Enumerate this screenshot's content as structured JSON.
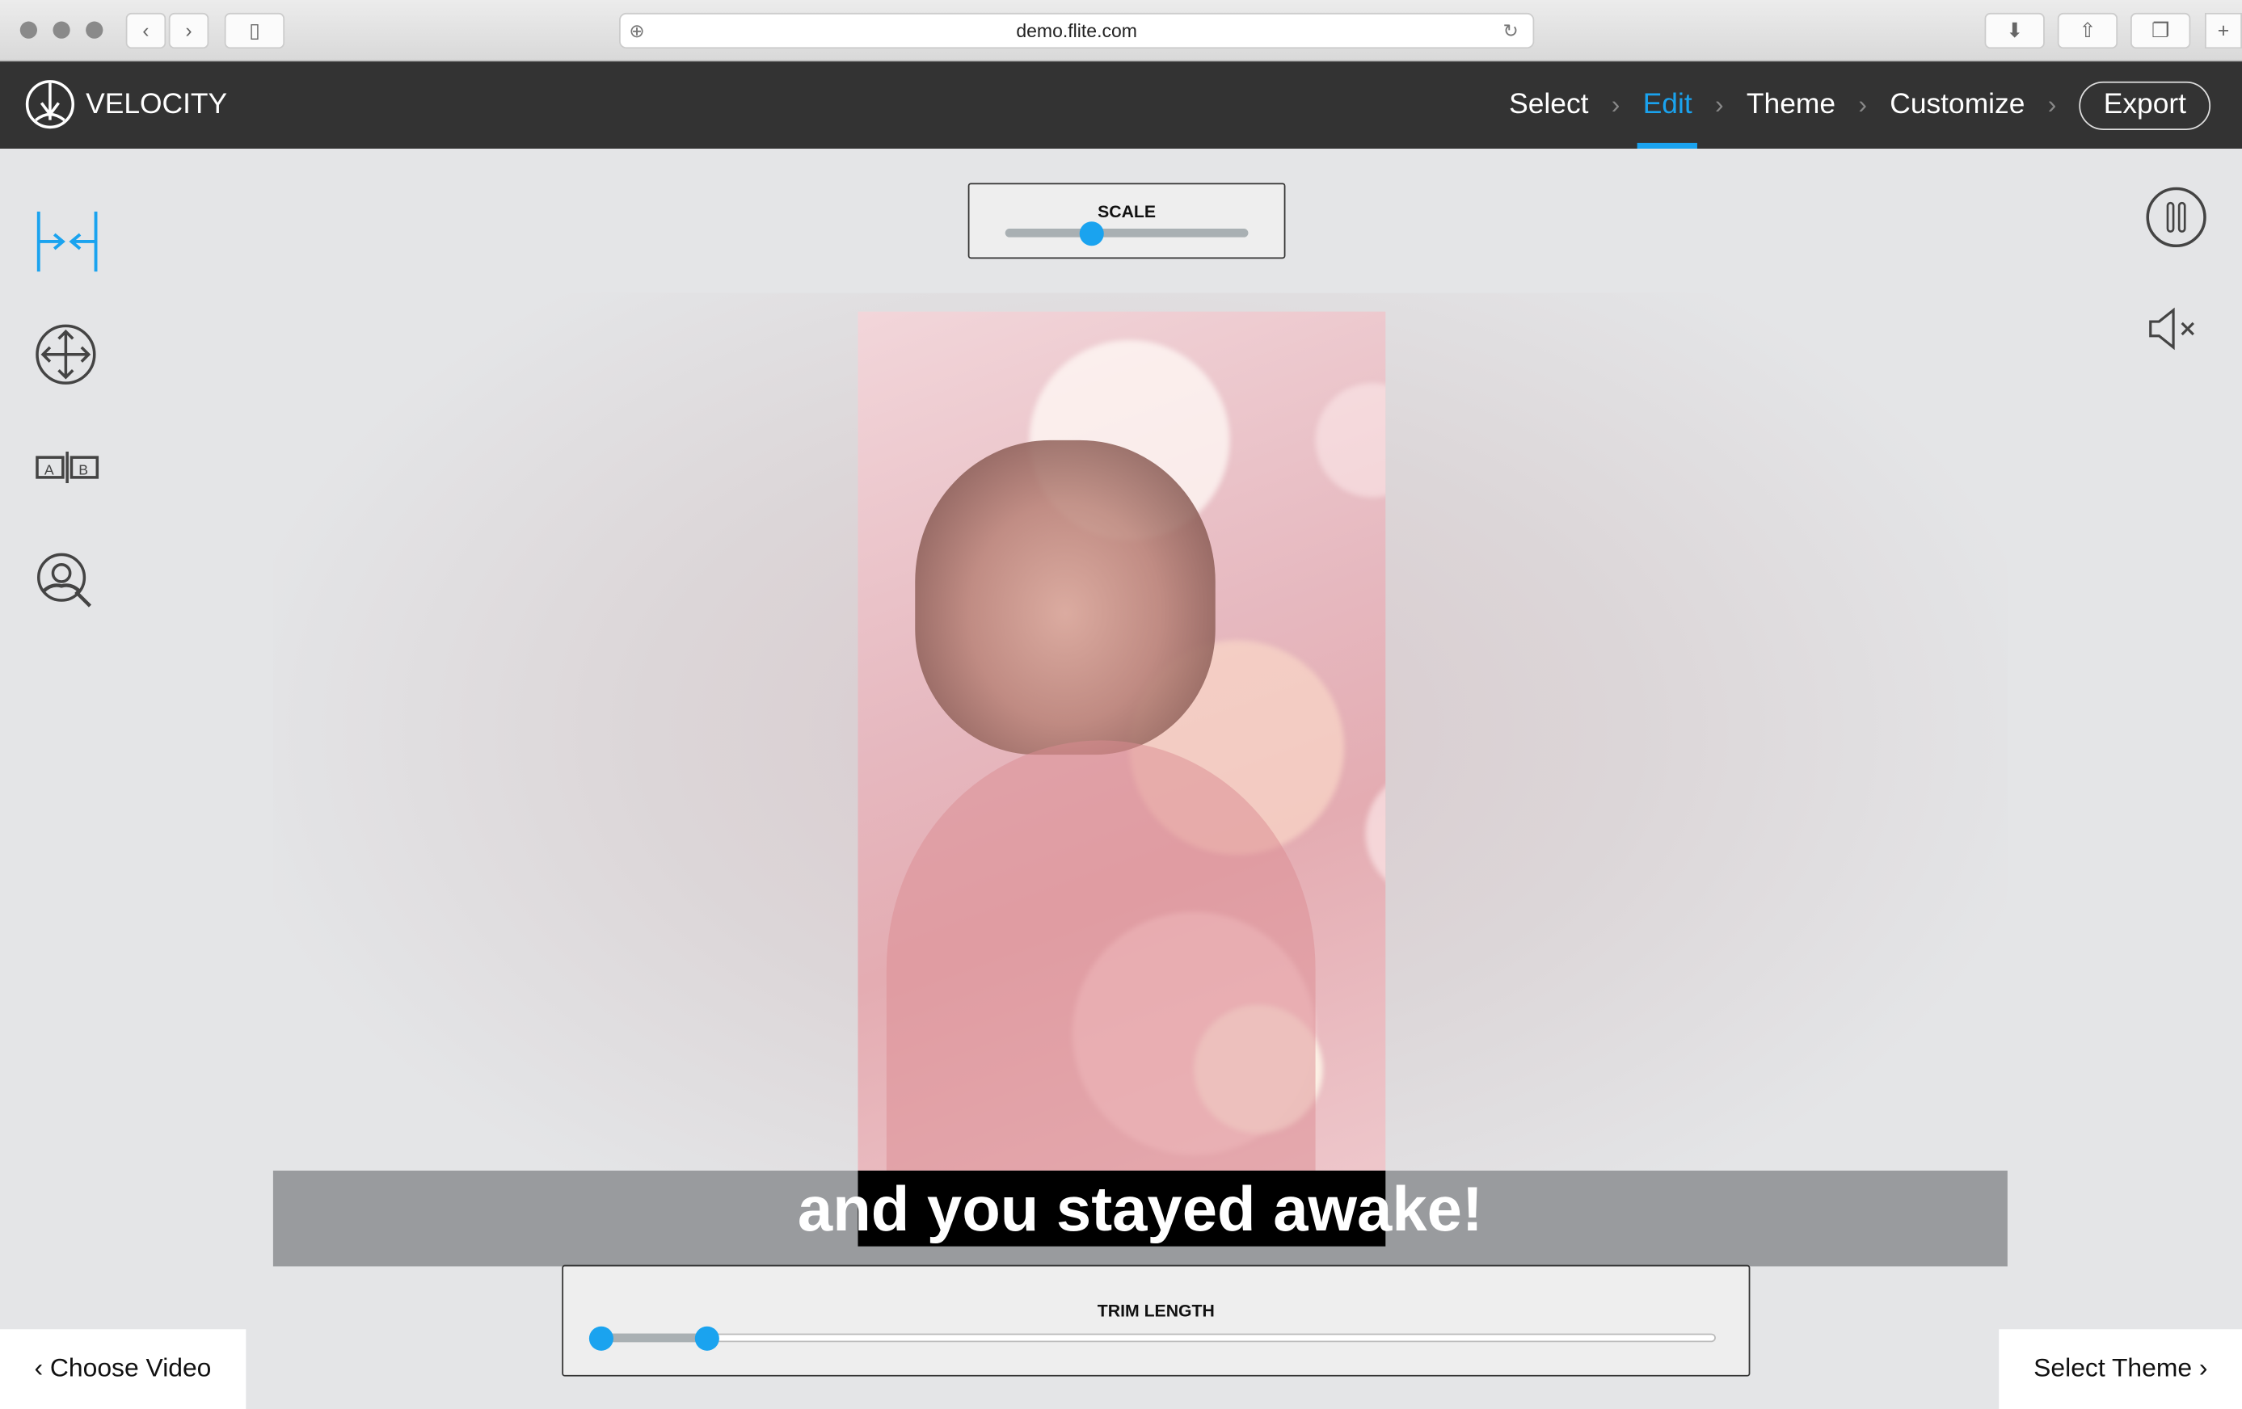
{
  "browser": {
    "url": "demo.flite.com"
  },
  "app": {
    "brand": "VELOCITY",
    "accent": "#1aa3ef"
  },
  "steps": [
    {
      "label": "Select"
    },
    {
      "label": "Edit",
      "active": true
    },
    {
      "label": "Theme"
    },
    {
      "label": "Customize"
    }
  ],
  "export_label": "Export",
  "tools": [
    "fit-width-icon",
    "move-icon",
    "ab-split-icon",
    "face-search-icon"
  ],
  "scale": {
    "label": "SCALE",
    "value": 0.35
  },
  "caption": "and you stayed awake!",
  "trim": {
    "label": "TRIM LENGTH",
    "start": 0,
    "end": 0.1
  },
  "footer": {
    "back": "Choose Video",
    "next": "Select Theme"
  },
  "player": {
    "state": "playing",
    "muted": true
  }
}
